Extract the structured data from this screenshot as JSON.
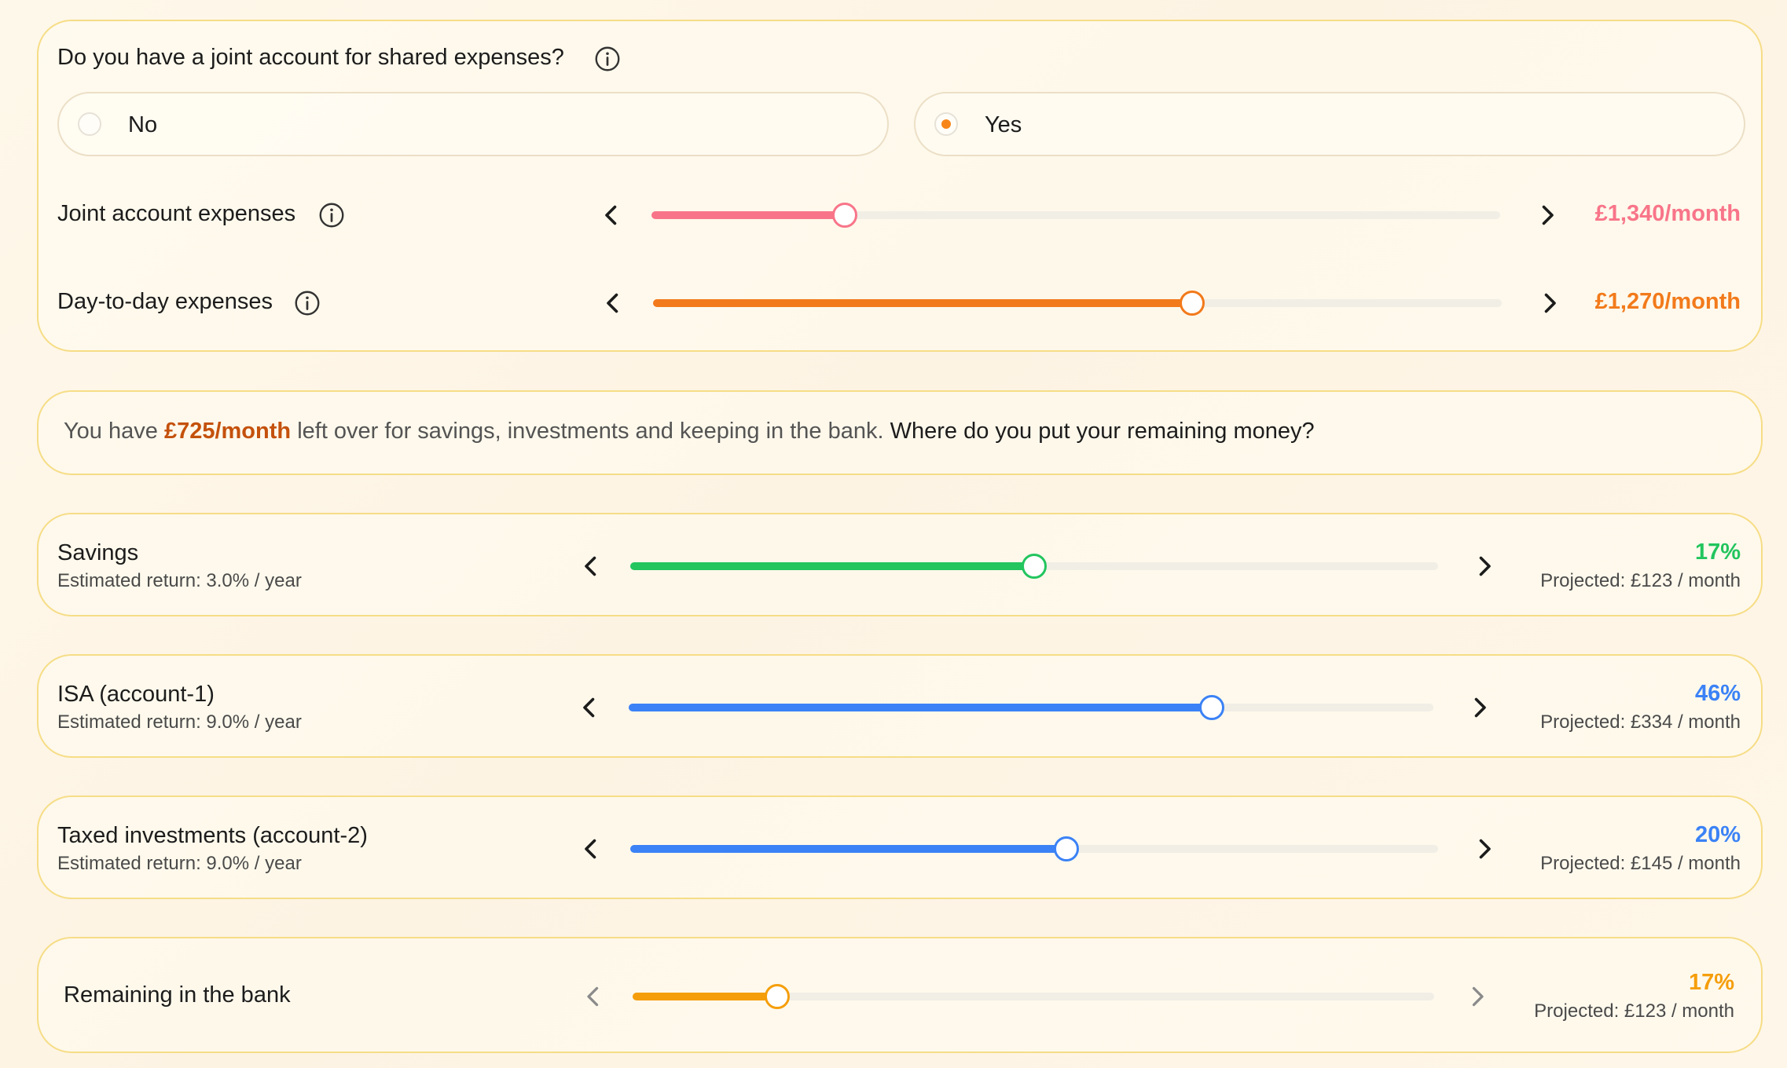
{
  "joint": {
    "question": "Do you have a joint account for shared expenses?",
    "options": [
      {
        "label": "No",
        "selected": false
      },
      {
        "label": "Yes",
        "selected": true
      }
    ],
    "sliders": [
      {
        "label": "Joint account expenses",
        "value": "£1,340/month",
        "fraction": 0.228,
        "color": "#f87589"
      },
      {
        "label": "Day-to-day expenses",
        "value": "£1,270/month",
        "fraction": 0.635,
        "color": "#f27a1b"
      }
    ]
  },
  "summary": {
    "prefix": "You have",
    "amount": "£725/month",
    "middle": "left over for savings, investments and keeping in the bank.",
    "question": "Where do you put your remaining money?"
  },
  "allocations": [
    {
      "title": "Savings",
      "subtitle": "Estimated return: 3.0% / year",
      "percent": "17%",
      "projected": "Projected: £123 / month",
      "fraction": 0.5,
      "color": "#22c55e"
    },
    {
      "title": "ISA (account-1)",
      "subtitle": "Estimated return: 9.0% / year",
      "percent": "46%",
      "projected": "Projected: £334 / month",
      "fraction": 0.725,
      "color": "#3b82f6"
    },
    {
      "title": "Taxed investments (account-2)",
      "subtitle": "Estimated return: 9.0% / year",
      "percent": "20%",
      "projected": "Projected: £145 / month",
      "fraction": 0.54,
      "color": "#3b82f6"
    },
    {
      "title": "Remaining in the bank",
      "subtitle": "",
      "percent": "17%",
      "projected": "Projected: £123 / month",
      "fraction": 0.18,
      "color": "#f59e0b"
    }
  ],
  "icons": {
    "info": "info-icon",
    "left": "chevron-left-icon",
    "right": "chevron-right-icon"
  }
}
